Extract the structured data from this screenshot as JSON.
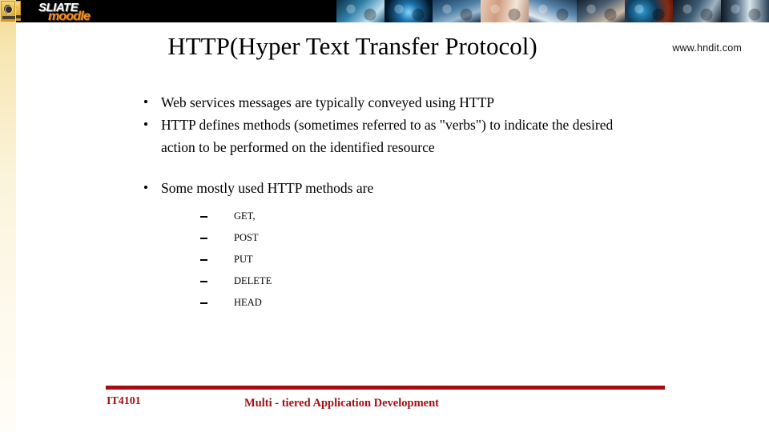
{
  "banner": {
    "badge_icon": "institution-crest-icon",
    "wordmark_primary": "SLIATE",
    "wordmark_secondary": "moodle",
    "collage_tiles": [
      "astronaut-tech-photo",
      "blue-globe-eye-photo",
      "cloud-network-hand-photo",
      "people-collaboration-photo",
      "hands-keyboard-photo",
      "classroom-students-photo",
      "globe-fire-photo",
      "robot-head-photo",
      "human-eye-photo"
    ]
  },
  "sidebar": {
    "badge_icon": "institution-crest-icon"
  },
  "slide": {
    "title": "HTTP(Hyper Text Transfer Protocol)",
    "watermark": "www.hndit.com",
    "bullets": [
      "Web services messages are typically conveyed using HTTP",
      "HTTP defines methods (sometimes referred to as \"verbs\") to indicate the desired action to be performed on the identified resource",
      "Some mostly used  HTTP methods are"
    ],
    "methods": [
      "GET,",
      "POST",
      "PUT",
      "DELETE",
      "HEAD"
    ]
  },
  "footer": {
    "course_code": "IT4101",
    "course_title": "Multi - tiered Application Development",
    "rule_color": "#a80c12",
    "text_color": "#a20f15"
  }
}
